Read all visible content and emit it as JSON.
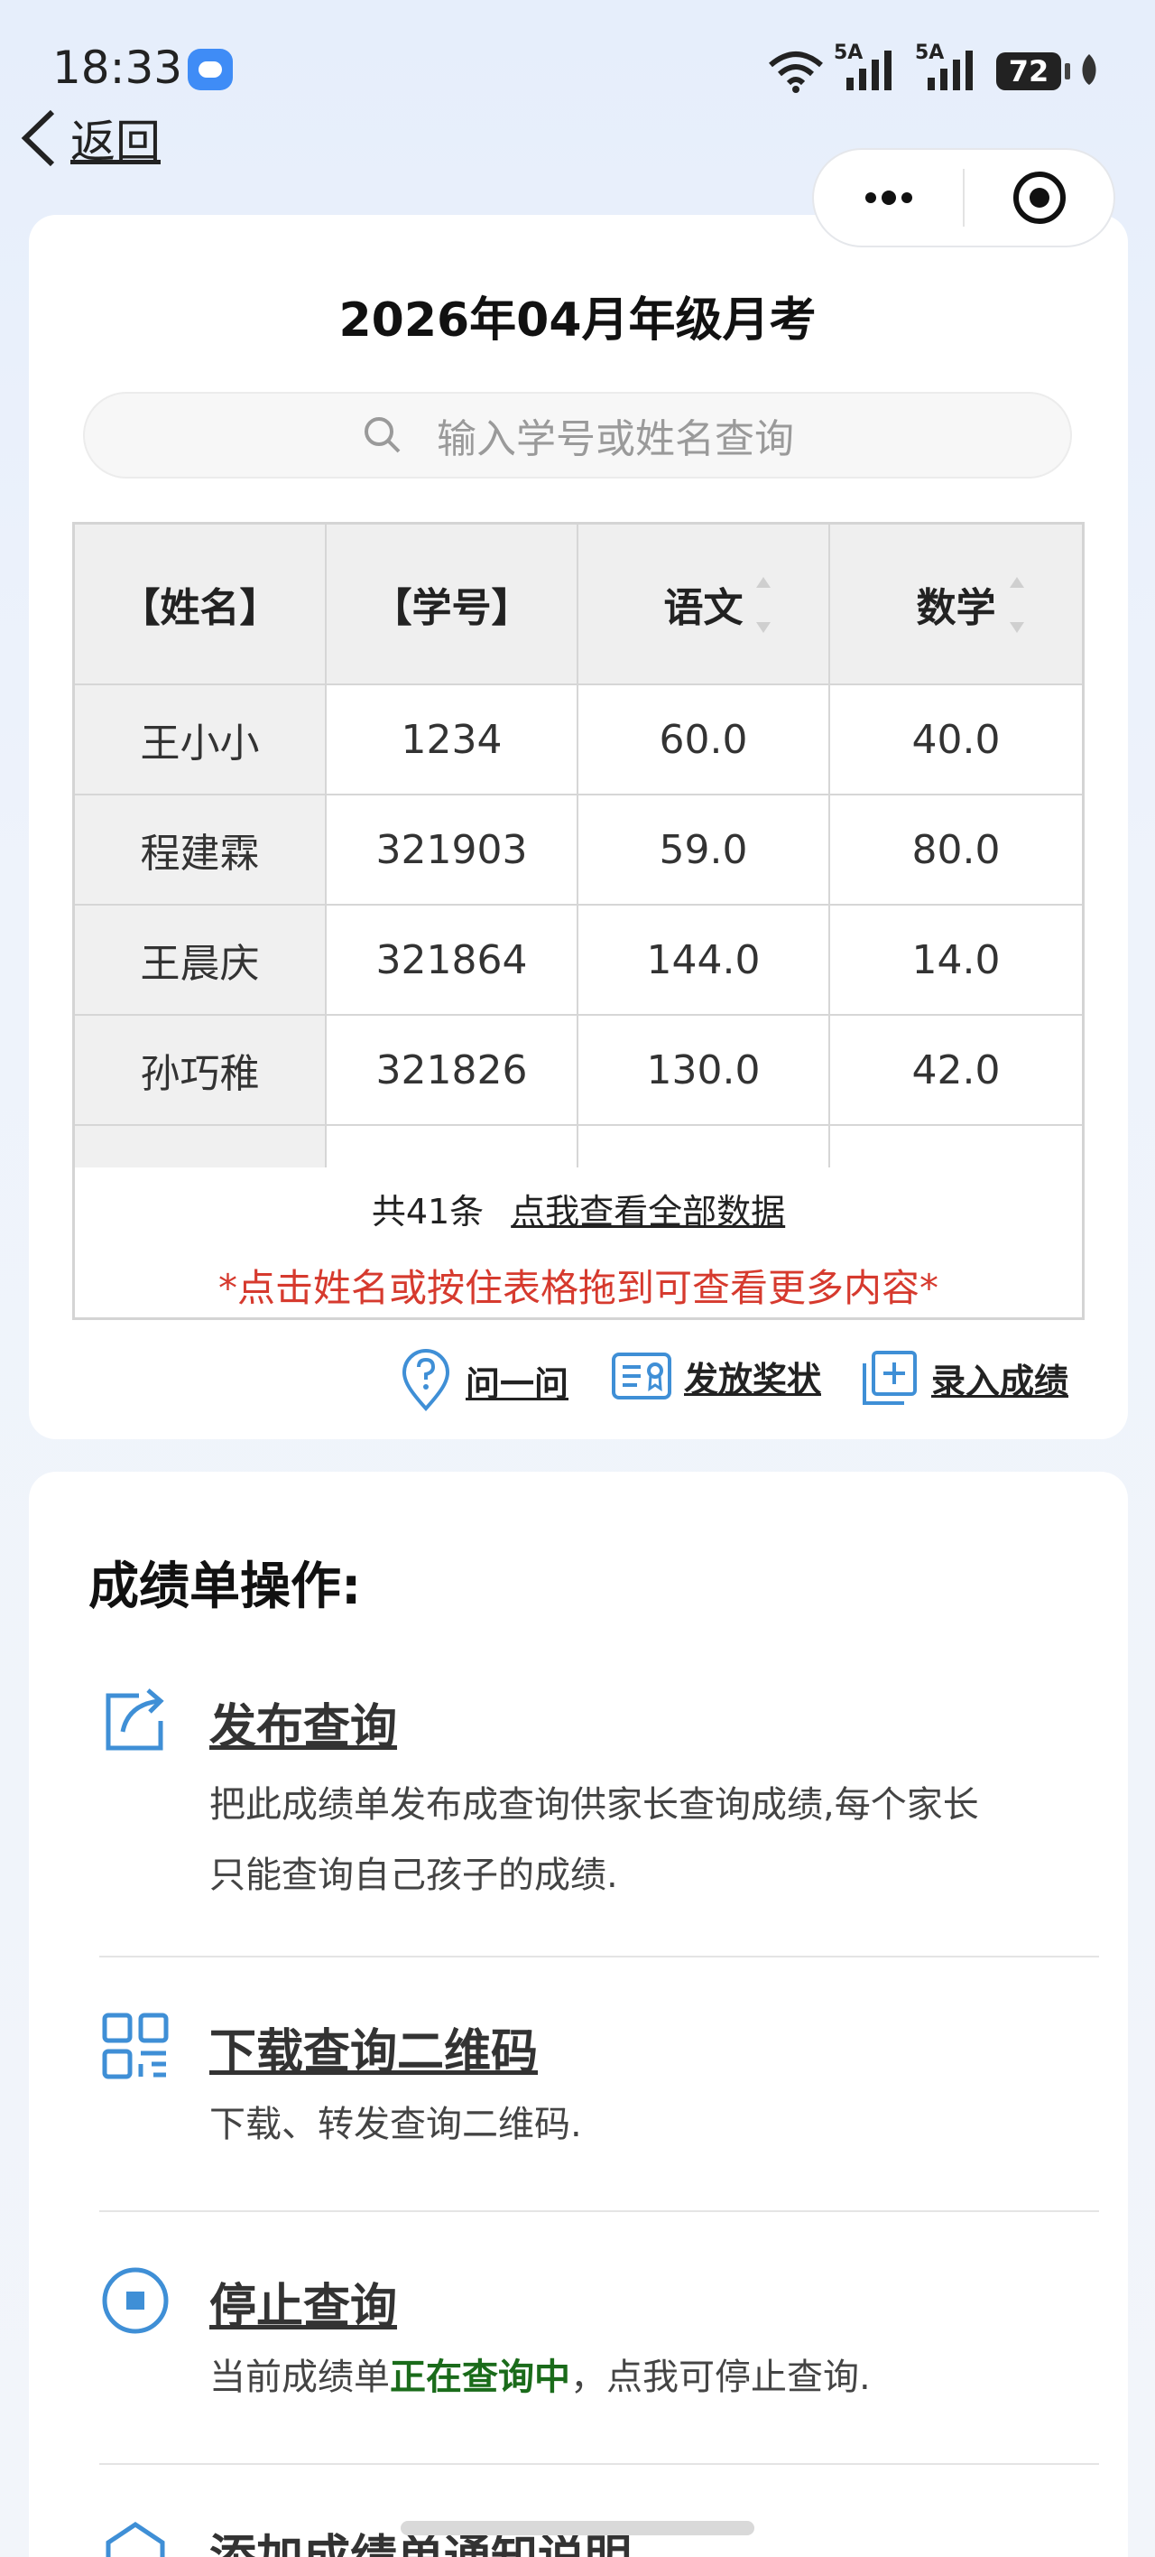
{
  "status_bar": {
    "time": "18:33",
    "signal_1": "5A",
    "signal_2": "5A",
    "battery": "72"
  },
  "nav": {
    "back_label": "返回"
  },
  "title": "2026年04月年级月考",
  "search": {
    "placeholder": "输入学号或姓名查询"
  },
  "table": {
    "columns": [
      "【姓名】",
      "【学号】",
      "语文",
      "数学"
    ],
    "rows": [
      [
        "王小小",
        "1234",
        "60.0",
        "40.0"
      ],
      [
        "程建霖",
        "321903",
        "59.0",
        "80.0"
      ],
      [
        "王晨庆",
        "321864",
        "144.0",
        "14.0"
      ],
      [
        "孙巧稚",
        "321826",
        "130.0",
        "42.0"
      ]
    ],
    "count": "共41条",
    "view_all": "点我查看全部数据",
    "hint": "*点击姓名或按住表格拖到可查看更多内容*"
  },
  "actions": {
    "ask": "问一问",
    "award": "发放奖状",
    "enter": "录入成绩"
  },
  "ops": {
    "title": "成绩单操作:",
    "publish": {
      "title": "发布查询",
      "desc": "把此成绩单发布成查询供家长查询成绩,每个家长只能查询自己孩子的成绩."
    },
    "qrcode": {
      "title": "下载查询二维码",
      "desc": "下载、转发查询二维码."
    },
    "stop": {
      "title": "停止查询",
      "desc_prefix": "当前成绩单",
      "desc_status": "正在查询中",
      "desc_suffix": "，点我可停止查询."
    },
    "notice": {
      "title": "添加成绩单通知说明"
    }
  },
  "colors": {
    "accent": "#3f8fd6",
    "hint_red": "#d63a2e",
    "status_green": "#1a6b1a"
  }
}
